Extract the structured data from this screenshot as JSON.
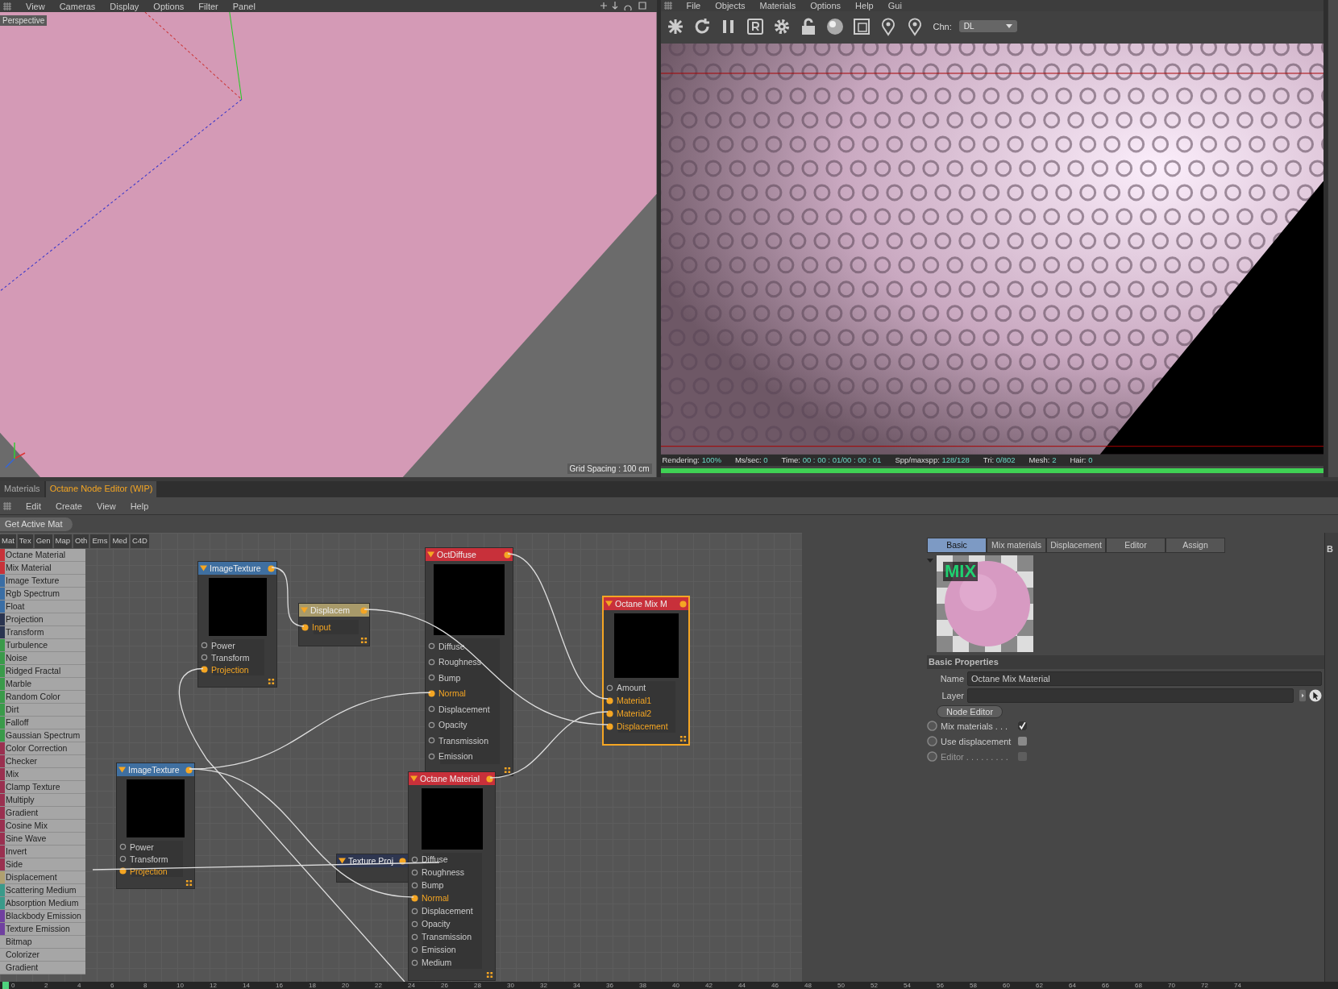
{
  "viewport": {
    "menu": [
      "View",
      "Cameras",
      "Display",
      "Options",
      "Filter",
      "Panel"
    ],
    "camera_label": "Perspective",
    "grid_spacing": "Grid Spacing : 100 cm"
  },
  "render_view": {
    "menu": [
      "File",
      "Objects",
      "Materials",
      "Options",
      "Help",
      "Gui"
    ],
    "channel_label": "Chn:",
    "channel_value": "DL",
    "stats": [
      {
        "label": "Rendering:",
        "value": "100%"
      },
      {
        "label": "Ms/sec:",
        "value": "0"
      },
      {
        "label": "Time:",
        "value": "00 : 00 : 01/00 : 00 : 01"
      },
      {
        "label": "Spp/maxspp:",
        "value": "128/128"
      },
      {
        "label": "Tri:",
        "value": "0/802"
      },
      {
        "label": "Mesh:",
        "value": "2"
      },
      {
        "label": "Hair:",
        "value": "0"
      }
    ],
    "progress": {
      "level": 1
    }
  },
  "editor_tabs": [
    {
      "label": "Materials",
      "selected": false
    },
    {
      "label": "Octane Node Editor (WIP)",
      "selected": true
    }
  ],
  "editor_menu": [
    "Edit",
    "Create",
    "View",
    "Help"
  ],
  "get_active_button": "Get Active Mat",
  "categories": [
    "Mat",
    "Tex",
    "Gen",
    "Map",
    "Oth",
    "Ems",
    "Med",
    "C4D"
  ],
  "node_types": [
    {
      "label": "Octane Material",
      "color": "#c8323a"
    },
    {
      "label": "Mix Material",
      "color": "#c8323a"
    },
    {
      "label": "Image Texture",
      "color": "#3a6ea5"
    },
    {
      "label": "Rgb Spectrum",
      "color": "#3a6ea5"
    },
    {
      "label": "Float",
      "color": "#3a6ea5"
    },
    {
      "label": "Projection",
      "color": "#2a3450"
    },
    {
      "label": "Transform",
      "color": "#2a3450"
    },
    {
      "label": "Turbulence",
      "color": "#3a9a4a"
    },
    {
      "label": "Noise",
      "color": "#3a9a4a"
    },
    {
      "label": "Ridged Fractal",
      "color": "#3a9a4a"
    },
    {
      "label": "Marble",
      "color": "#3a9a4a"
    },
    {
      "label": "Random Color",
      "color": "#3a9a4a"
    },
    {
      "label": "Dirt",
      "color": "#3a9a4a"
    },
    {
      "label": "Falloff",
      "color": "#3a9a4a"
    },
    {
      "label": "Gaussian Spectrum",
      "color": "#3a9a4a"
    },
    {
      "label": "Color Correction",
      "color": "#9a3050"
    },
    {
      "label": "Checker",
      "color": "#9a3050"
    },
    {
      "label": "Mix",
      "color": "#9a3050"
    },
    {
      "label": "Clamp Texture",
      "color": "#9a3050"
    },
    {
      "label": "Multiply",
      "color": "#9a3050"
    },
    {
      "label": "Gradient",
      "color": "#9a3050"
    },
    {
      "label": "Cosine Mix",
      "color": "#9a3050"
    },
    {
      "label": "Sine Wave",
      "color": "#9a3050"
    },
    {
      "label": "Invert",
      "color": "#9a3050"
    },
    {
      "label": "Side",
      "color": "#9a3050"
    },
    {
      "label": "Displacement",
      "color": "#b0a070"
    },
    {
      "label": "Scattering Medium",
      "color": "#3a9a8a"
    },
    {
      "label": "Absorption Medium",
      "color": "#3a9a8a"
    },
    {
      "label": "Blackbody Emission",
      "color": "#7040a0"
    },
    {
      "label": "Texture Emission",
      "color": "#7040a0"
    },
    {
      "label": "Bitmap"
    },
    {
      "label": "Colorizer"
    },
    {
      "label": "Gradient"
    }
  ],
  "nodes": [
    {
      "title": "ImageTexture",
      "kind": "texture",
      "selected": false,
      "ports": [
        {
          "label": "Power",
          "connected": false
        },
        {
          "label": "Transform",
          "connected": false
        },
        {
          "label": "Projection",
          "connected": true
        }
      ]
    },
    {
      "title": "Displacem",
      "kind": "displacement",
      "selected": false,
      "ports": [
        {
          "label": "Input",
          "connected": true
        }
      ]
    },
    {
      "title": "OctDiffuse",
      "kind": "material",
      "selected": false,
      "ports": [
        {
          "label": "Diffuse",
          "connected": false
        },
        {
          "label": "Roughness",
          "connected": false
        },
        {
          "label": "Bump",
          "connected": false
        },
        {
          "label": "Normal",
          "connected": true
        },
        {
          "label": "Displacement",
          "connected": false
        },
        {
          "label": "Opacity",
          "connected": false
        },
        {
          "label": "Transmission",
          "connected": false
        },
        {
          "label": "Emission",
          "connected": false
        }
      ]
    },
    {
      "title": "Octane Mix M",
      "kind": "mix",
      "selected": true,
      "ports": [
        {
          "label": "Amount",
          "connected": false
        },
        {
          "label": "Material1",
          "connected": true
        },
        {
          "label": "Material2",
          "connected": true
        },
        {
          "label": "Displacement",
          "connected": true
        }
      ]
    },
    {
      "title": "ImageTexture",
      "kind": "texture",
      "selected": false,
      "ports": [
        {
          "label": "Power",
          "connected": false
        },
        {
          "label": "Transform",
          "connected": false
        },
        {
          "label": "Projection",
          "connected": true
        }
      ]
    },
    {
      "title": "Texture Proj",
      "kind": "projection",
      "selected": false
    },
    {
      "title": "Octane Material",
      "kind": "material",
      "selected": false,
      "ports": [
        {
          "label": "Diffuse",
          "connected": false
        },
        {
          "label": "Roughness",
          "connected": false
        },
        {
          "label": "Bump",
          "connected": false
        },
        {
          "label": "Normal",
          "connected": true
        },
        {
          "label": "Displacement",
          "connected": false
        },
        {
          "label": "Opacity",
          "connected": false
        },
        {
          "label": "Transmission",
          "connected": false
        },
        {
          "label": "Emission",
          "connected": false
        },
        {
          "label": "Medium",
          "connected": false
        }
      ]
    }
  ],
  "properties": {
    "tabs": [
      {
        "label": "Basic",
        "selected": true
      },
      {
        "label": "Mix materials",
        "selected": false
      },
      {
        "label": "Displacement",
        "selected": false
      },
      {
        "label": "Editor",
        "selected": false
      },
      {
        "label": "Assign",
        "selected": false
      }
    ],
    "preview_badge": "MIX",
    "section_title": "Basic Properties",
    "name_label": "Name",
    "name_value": "Octane Mix Material",
    "layer_label": "Layer",
    "node_editor_button": "Node Editor",
    "options": [
      {
        "label": "Mix materials . . .",
        "checked": true,
        "disabled": false
      },
      {
        "label": "Use displacement",
        "checked": false,
        "disabled": false
      },
      {
        "label": "Editor . . . . . . . . .",
        "checked": false,
        "disabled": true
      }
    ]
  },
  "side_strip_label": "B",
  "timeline": {
    "frames": [
      "0",
      "2",
      "4",
      "6",
      "8",
      "10",
      "12",
      "14",
      "16",
      "18",
      "20",
      "22",
      "24",
      "26",
      "28",
      "30",
      "32",
      "34",
      "36",
      "38",
      "40",
      "42",
      "44",
      "46",
      "48",
      "50",
      "52",
      "54",
      "56",
      "58",
      "60",
      "62",
      "64",
      "66",
      "68",
      "70",
      "72",
      "74"
    ]
  }
}
